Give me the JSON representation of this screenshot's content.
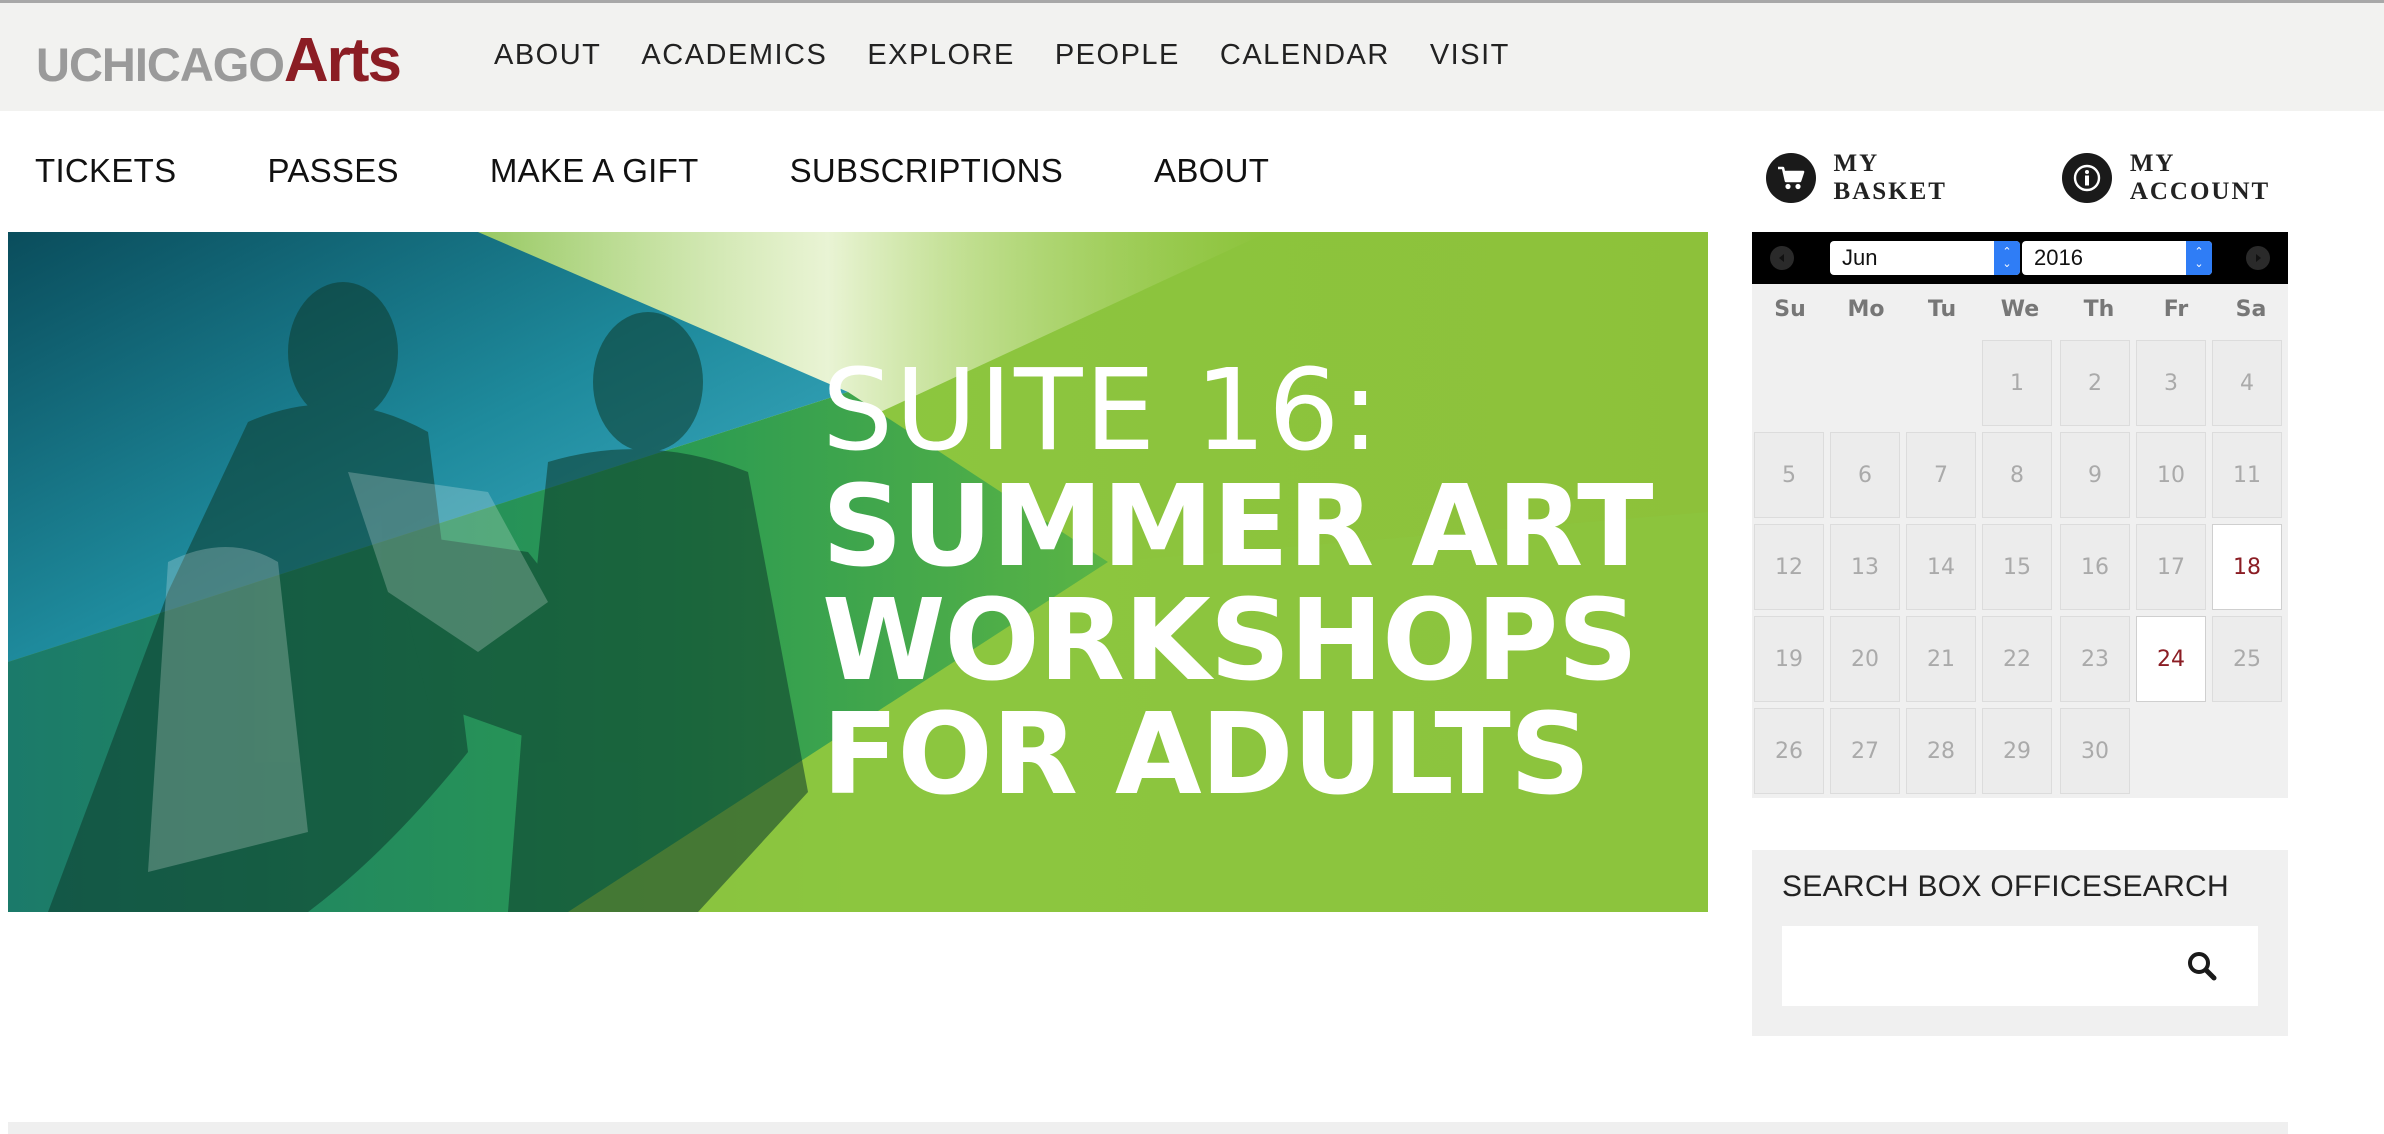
{
  "brand": {
    "logo_part1": "UCHICAGO",
    "logo_part2": "Arts",
    "accent": "#8b1d24"
  },
  "top_nav": [
    "ABOUT",
    "ACADEMICS",
    "EXPLORE",
    "PEOPLE",
    "CALENDAR",
    "VISIT"
  ],
  "sub_nav": [
    "TICKETS",
    "PASSES",
    "MAKE A GIFT",
    "SUBSCRIPTIONS",
    "ABOUT"
  ],
  "account": {
    "basket": "MY BASKET",
    "account": "MY ACCOUNT"
  },
  "hero": {
    "line1": "SUITE 16:",
    "line2": "SUMMER ART",
    "line3": "WORKSHOPS",
    "line4": "FOR ADULTS",
    "bg_color": "#8cc63f"
  },
  "calendar": {
    "month": "Jun",
    "year": "2016",
    "weekdays": [
      "Su",
      "Mo",
      "Tu",
      "We",
      "Th",
      "Fr",
      "Sa"
    ],
    "days": [
      "1",
      "2",
      "3",
      "4",
      "5",
      "6",
      "7",
      "8",
      "9",
      "10",
      "11",
      "12",
      "13",
      "14",
      "15",
      "16",
      "17",
      "18",
      "19",
      "20",
      "21",
      "22",
      "23",
      "24",
      "25",
      "26",
      "27",
      "28",
      "29",
      "30"
    ],
    "first_weekday": 3,
    "highlighted": [
      "18",
      "24"
    ]
  },
  "search": {
    "title": "SEARCH BOX OFFICESEARCH",
    "placeholder": ""
  }
}
